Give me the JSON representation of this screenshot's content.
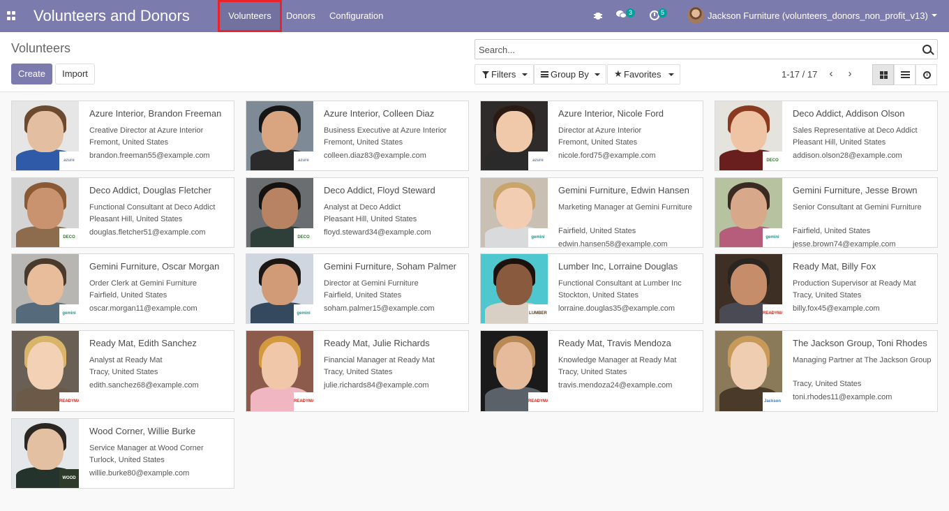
{
  "app": {
    "title": "Volunteers and Donors"
  },
  "nav": {
    "menus": [
      "Volunteers",
      "Donors",
      "Configuration"
    ],
    "messages_count": "3",
    "activities_count": "5",
    "user": "Jackson Furniture (volunteers_donors_non_profit_v13)"
  },
  "control": {
    "title": "Volunteers",
    "create": "Create",
    "import": "Import",
    "search_placeholder": "Search...",
    "filters": "Filters",
    "group_by": "Group By",
    "favorites": "Favorites",
    "pager": "1-17 / 17"
  },
  "colors": {
    "navbar": "#7c7bad",
    "badge": "#00a09d",
    "highlight": "#e8232a"
  },
  "cards": [
    {
      "name": "Azure Interior, Brandon Freeman",
      "func": "Creative Director at Azure Interior",
      "loc": "Fremont, United States",
      "email": "brandon.freeman55@example.com",
      "logo": "azure"
    },
    {
      "name": "Azure Interior, Colleen Diaz",
      "func": "Business Executive at Azure Interior",
      "loc": "Fremont, United States",
      "email": "colleen.diaz83@example.com",
      "logo": "azure"
    },
    {
      "name": "Azure Interior, Nicole Ford",
      "func": "Director at Azure Interior",
      "loc": "Fremont, United States",
      "email": "nicole.ford75@example.com",
      "logo": "azure"
    },
    {
      "name": "Deco Addict, Addison Olson",
      "func": "Sales Representative at Deco Addict",
      "loc": "Pleasant Hill, United States",
      "email": "addison.olson28@example.com",
      "logo": "deco"
    },
    {
      "name": "Deco Addict, Douglas Fletcher",
      "func": "Functional Consultant at Deco Addict",
      "loc": "Pleasant Hill, United States",
      "email": "douglas.fletcher51@example.com",
      "logo": "deco"
    },
    {
      "name": "Deco Addict, Floyd Steward",
      "func": "Analyst at Deco Addict",
      "loc": "Pleasant Hill, United States",
      "email": "floyd.steward34@example.com",
      "logo": "deco"
    },
    {
      "name": "Gemini Furniture, Edwin Hansen",
      "func": "Marketing Manager at Gemini Furniture",
      "loc": "Fairfield, United States",
      "email": "edwin.hansen58@example.com",
      "logo": "gemini"
    },
    {
      "name": "Gemini Furniture, Jesse Brown",
      "func": "Senior Consultant at Gemini Furniture",
      "loc": "Fairfield, United States",
      "email": "jesse.brown74@example.com",
      "logo": "gemini"
    },
    {
      "name": "Gemini Furniture, Oscar Morgan",
      "func": "Order Clerk at Gemini Furniture",
      "loc": "Fairfield, United States",
      "email": "oscar.morgan11@example.com",
      "logo": "gemini"
    },
    {
      "name": "Gemini Furniture, Soham Palmer",
      "func": "Director at Gemini Furniture",
      "loc": "Fairfield, United States",
      "email": "soham.palmer15@example.com",
      "logo": "gemini"
    },
    {
      "name": "Lumber Inc, Lorraine Douglas",
      "func": "Functional Consultant at Lumber Inc",
      "loc": "Stockton, United States",
      "email": "lorraine.douglas35@example.com",
      "logo": "lumber"
    },
    {
      "name": "Ready Mat, Billy Fox",
      "func": "Production Supervisor at Ready Mat",
      "loc": "Tracy, United States",
      "email": "billy.fox45@example.com",
      "logo": "readymat"
    },
    {
      "name": "Ready Mat, Edith Sanchez",
      "func": "Analyst at Ready Mat",
      "loc": "Tracy, United States",
      "email": "edith.sanchez68@example.com",
      "logo": "readymat"
    },
    {
      "name": "Ready Mat, Julie Richards",
      "func": "Financial Manager at Ready Mat",
      "loc": "Tracy, United States",
      "email": "julie.richards84@example.com",
      "logo": "readymat"
    },
    {
      "name": "Ready Mat, Travis Mendoza",
      "func": "Knowledge Manager at Ready Mat",
      "loc": "Tracy, United States",
      "email": "travis.mendoza24@example.com",
      "logo": "readymat"
    },
    {
      "name": "The Jackson Group, Toni Rhodes",
      "func": "Managing Partner at The Jackson Group",
      "loc": "Tracy, United States",
      "email": "toni.rhodes11@example.com",
      "logo": "jackson"
    },
    {
      "name": "Wood Corner, Willie Burke",
      "func": "Service Manager at Wood Corner",
      "loc": "Turlock, United States",
      "email": "willie.burke80@example.com",
      "logo": "woodcorner"
    }
  ]
}
